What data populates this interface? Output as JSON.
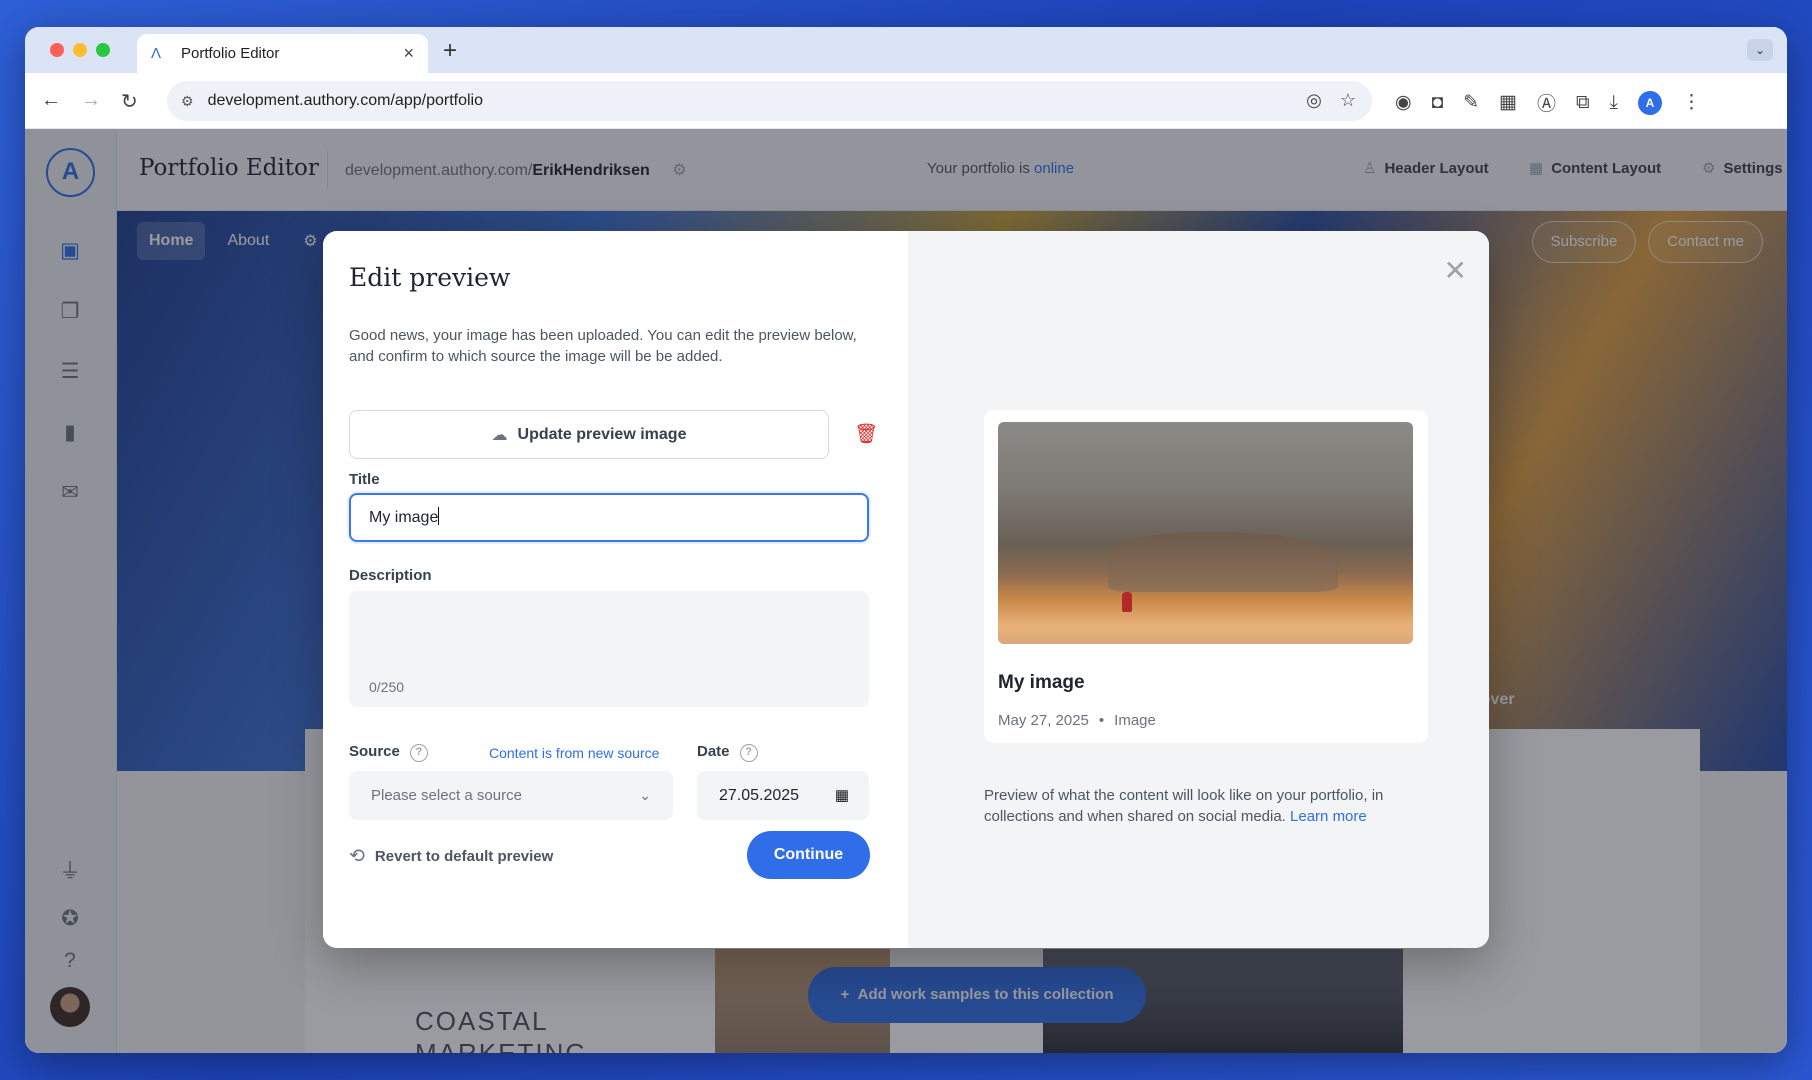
{
  "browser": {
    "tab_title": "Portfolio Editor",
    "tab_close": "×",
    "new_tab": "+",
    "tab_menu": "⌄",
    "url": "development.authory.com/app/portfolio",
    "profile_initial": "A",
    "traffic_lights": [
      "#ff5f57",
      "#febc2e",
      "#28c840"
    ]
  },
  "app": {
    "logo": "A",
    "title": "Portfolio Editor",
    "domain_prefix": "development.authory.com/",
    "domain_user": "ErikHendriksen",
    "status_prefix": "Your portfolio is ",
    "status_value": "online",
    "header_buttons": {
      "header_layout": "Header Layout",
      "content_layout": "Content Layout",
      "settings": "Settings"
    },
    "sidebar_icons": [
      "portfolio-icon",
      "collections-icon",
      "content-icon",
      "analytics-icon",
      "newsletter-icon",
      "integrations-icon",
      "achievements-icon",
      "help-icon"
    ]
  },
  "portfolio": {
    "nav": {
      "home": "Home",
      "about": "About"
    },
    "subscribe": "Subscribe",
    "contact": "Contact me",
    "edit_cover": "Edit Cover",
    "coastal_text": "COASTAL\nMARKETING",
    "add_work": "Add work samples to this collection"
  },
  "modal": {
    "title": "Edit preview",
    "description": "Good news, your image has been uploaded. You can edit the preview below, and confirm to which source the image will be be added.",
    "update_button": "Update preview image",
    "title_label": "Title",
    "title_value": "My image",
    "description_label": "Description",
    "description_counter": "0/250",
    "source_label": "Source",
    "new_source_link": "Content is from new source",
    "source_placeholder": "Please select a source",
    "date_label": "Date",
    "date_value": "27.05.2025",
    "revert": "Revert to default preview",
    "continue": "Continue",
    "preview": {
      "name": "My image",
      "date": "May 27, 2025",
      "type": "Image",
      "note": "Preview of what the content will look like on your portfolio, in collections and when shared on social media.",
      "learn_more": "Learn more"
    }
  },
  "colors": {
    "accent": "#2f6ee8",
    "danger": "#dc2626"
  }
}
